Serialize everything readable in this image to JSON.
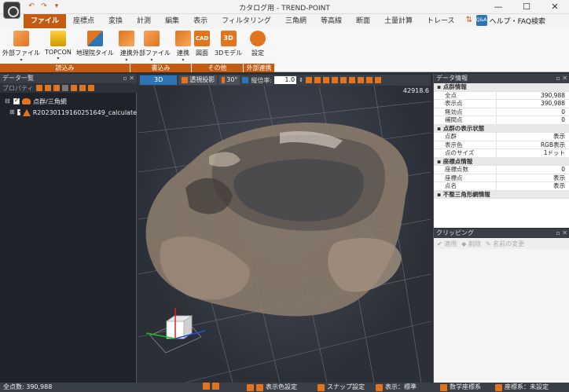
{
  "window": {
    "title": "カタログ用 - TREND-POINT",
    "minimize": "—",
    "maximize": "☐",
    "close": "✕"
  },
  "ribbon_tabs": [
    "ファイル",
    "座標点",
    "変換",
    "計測",
    "編集",
    "表示",
    "フィルタリング",
    "三角網",
    "等高線",
    "断面",
    "土量計算",
    "トレース"
  ],
  "help_label": "ヘルプ・FAQ検索",
  "help_icon_text": "Q&A",
  "ribbon_groups": [
    {
      "label": "読込み",
      "buttons": [
        "外部ファイル",
        "TOPCON",
        "地理院タイル",
        "連携"
      ]
    },
    {
      "label": "書込み",
      "buttons": [
        "外部ファイル",
        "連携"
      ]
    },
    {
      "label": "その他",
      "buttons": [
        "図面",
        "3Dモデル"
      ]
    },
    {
      "label": "外部連携",
      "buttons": [
        "設定"
      ]
    }
  ],
  "icon_texts": {
    "cad": "CAD",
    "model3d": "3D"
  },
  "data_panel": {
    "title": "データ一覧",
    "toolbar_label": "プロパティ",
    "tree": [
      {
        "label": "点群/三角網",
        "level": 0
      },
      {
        "label": "R20230119160251649_calculate",
        "level": 1
      }
    ]
  },
  "view_toolbar": {
    "mode": "3D",
    "perspective": "透視投影",
    "angle": "30°",
    "vertical_scale_label": "縦倍率:",
    "vertical_scale_value": "1.0"
  },
  "viewport": {
    "coord_readout": "42918.6"
  },
  "props_panel": {
    "title": "データ情報",
    "rows": [
      {
        "type": "cat",
        "k": "点群情報"
      },
      {
        "k": "全点",
        "v": "390,988"
      },
      {
        "k": "表示点",
        "v": "390,988"
      },
      {
        "k": "無効点",
        "v": "0"
      },
      {
        "k": "補間点",
        "v": "0"
      },
      {
        "type": "cat",
        "k": "点群の表示状態"
      },
      {
        "k": "点群",
        "v": "表示"
      },
      {
        "k": "表示色",
        "v": "RGB表示"
      },
      {
        "k": "点のサイズ",
        "v": "1ドット"
      },
      {
        "type": "cat",
        "k": "座標点情報"
      },
      {
        "k": "座標点数",
        "v": "0"
      },
      {
        "k": "座標点",
        "v": "表示"
      },
      {
        "k": "点名",
        "v": "表示"
      },
      {
        "type": "cat",
        "k": "不整三角形網情報"
      }
    ]
  },
  "clip_panel": {
    "title": "クリッピング",
    "apply": "適用",
    "delete": "削除",
    "rename": "名前の変更"
  },
  "status": {
    "total_points": "全点数: 390,988",
    "color_setting": "表示色設定",
    "snap_setting": "スナップ設定",
    "display_mode": "表示：標準",
    "math_coords": "数学座標系",
    "coord_system": "座標系：未設定"
  },
  "colors": {
    "accent": "#c55a11",
    "panel_dark": "#3a3f47",
    "view_blue": "#2e74b5"
  }
}
